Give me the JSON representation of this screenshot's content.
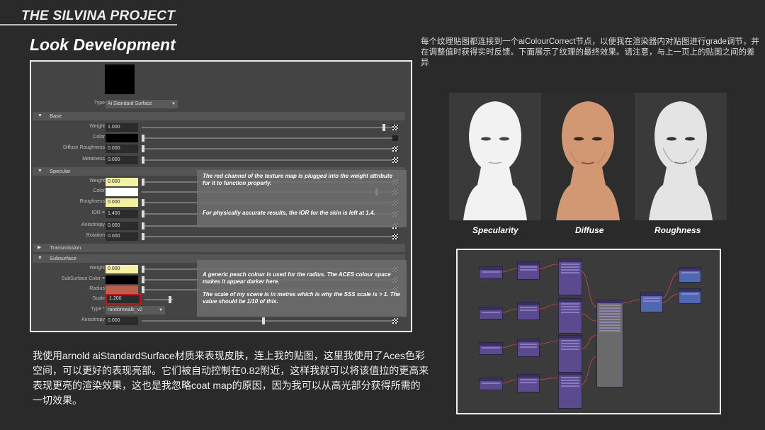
{
  "header": {
    "project_title": "THE SILVINA PROJECT",
    "page_title": "Look Development"
  },
  "notes": {
    "top": "每个纹理贴图都连接到一个aiColourCorrect节点，以便我在渲染器内对贴图进行grade调节，并在调整值时获得实时反馈。下面展示了纹理的最终效果。请注意，与上一页上的贴图之间的差异",
    "bottom": "我使用arnold aiStandardSurface材质来表现皮肤，连上我的贴图，这里我使用了Aces色彩空间，可以更好的表现亮部。它们被自动控制在0.82附近，这样我就可以将该值拉的更高来表现更亮的渲染效果，这也是我忽略coat map的原因，因为我可以从高光部分获得所需的一切效果。"
  },
  "attribute_editor": {
    "type_label": "Type",
    "type_value": "Ai Standard Surface",
    "sections": {
      "base": "Base",
      "specular": "Specular",
      "transmission": "Transmission",
      "subsurface": "Subsurface"
    },
    "base": {
      "weight_label": "Weight",
      "weight_value": "1.000",
      "color_label": "Color",
      "diffuse_roughness_label": "Diffuse Roughness",
      "diffuse_roughness_value": "0.000",
      "metalness_label": "Metalness",
      "metalness_value": "0.000"
    },
    "specular": {
      "weight_label": "Weight",
      "weight_value": "0.000",
      "color_label": "Color",
      "roughness_label": "Roughness",
      "roughness_value": "0.000",
      "ior_label": "IOR ≡",
      "ior_value": "1.400",
      "anisotropy_label": "Anisotropy",
      "anisotropy_value": "0.000",
      "rotation_label": "Rotation",
      "rotation_value": "0.000"
    },
    "subsurface": {
      "weight_label": "Weight",
      "weight_value": "0.000",
      "color_label": "SubSurface Color ≡",
      "radius_label": "Radius",
      "scale_label": "Scale",
      "scale_value": "1.200",
      "type_label": "Type *",
      "type_value": "randomwalk_v2",
      "anisotropy_label": "Anisotropy",
      "anisotropy_value": "0.000"
    },
    "annotations": {
      "weight_note": "The red channel of the texture map is plugged into the weight attribute for it to function properly.",
      "ior_note": "For physically accurate results, the IOR for the skin is left at 1.4.",
      "radius_note": "A generic peach colour is used for the radius. The ACES colour space makes it appear darker here.",
      "scale_note": "The scale of my scene is in metres which is why the SSS scale is > 1. The value should be 1/10 of this."
    },
    "colors": {
      "base_color": "#000000",
      "spec_color": "#ffffff",
      "sss_color": "#000000",
      "radius_color": "#b8604a",
      "highlight_border": "#c01818"
    }
  },
  "renders": {
    "captions": [
      "Specularity",
      "Diffuse",
      "Roughness"
    ]
  }
}
